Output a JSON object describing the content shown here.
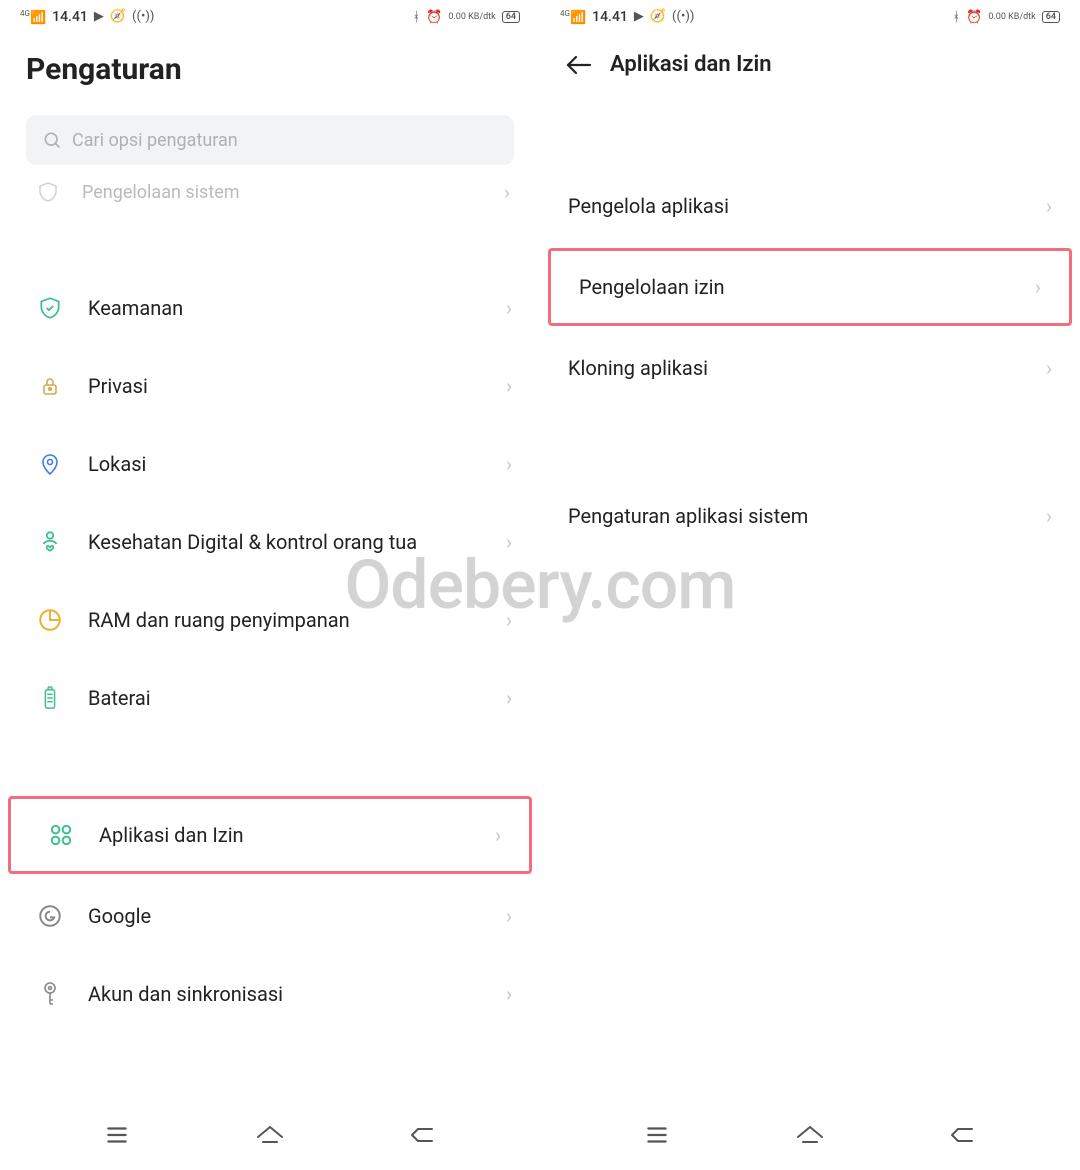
{
  "watermark_text": "Odebery.com",
  "status": {
    "signal_label": "4G",
    "time": "14.41",
    "net_rate": "0.00 KB/dtk",
    "battery": "64"
  },
  "left": {
    "title": "Pengaturan",
    "search_placeholder": "Cari opsi pengaturan",
    "peek_item": "Pengelolaan sistem",
    "items": {
      "keamanan": "Keamanan",
      "privasi": "Privasi",
      "lokasi": "Lokasi",
      "kesehatan": "Kesehatan Digital & kontrol orang tua",
      "ram": "RAM dan ruang penyimpanan",
      "baterai": "Baterai",
      "aplikasi_izin": "Aplikasi dan Izin",
      "google": "Google",
      "akun": "Akun dan sinkronisasi"
    }
  },
  "right": {
    "header": "Aplikasi dan Izin",
    "items": {
      "pengelola_aplikasi": "Pengelola aplikasi",
      "pengelolaan_izin": "Pengelolaan izin",
      "kloning": "Kloning aplikasi",
      "sistem_apps": "Pengaturan aplikasi sistem"
    }
  }
}
